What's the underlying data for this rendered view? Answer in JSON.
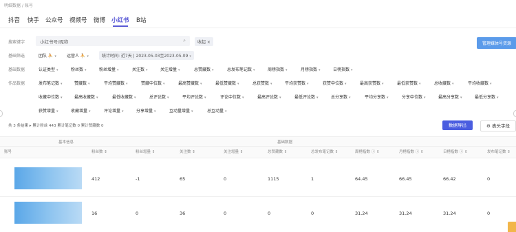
{
  "breadcrumb": "明细数据 / 账号",
  "tabs": [
    "抖音",
    "快手",
    "公众号",
    "视频号",
    "微博",
    "小红书",
    "B站"
  ],
  "search": {
    "label": "搜索键字",
    "placeholder": "小红书号/昵称",
    "tag": "收起 ×"
  },
  "manage_button": "管理媒体号资源",
  "basic_filter": {
    "label": "基础筛选",
    "team": "团队 ⛹",
    "operator": "运营人 ⛹",
    "period": "统计时间: 近7天 | 2023-05-03至2023-05-09"
  },
  "basic_data": {
    "label": "基础数据",
    "items": [
      "认证类型",
      "粉丝数",
      "粉丝增量",
      "关注数",
      "关注增量",
      "总赞藏数",
      "总发布笔记数",
      "周榜指数",
      "月榜指数",
      "日榜指数"
    ]
  },
  "works_data": {
    "label": "作品数据",
    "row1": [
      "发布笔记数",
      "赞藏数",
      "平均赞藏数",
      "赞藏中位数",
      "最高赞藏数",
      "最低赞藏数",
      "总获赞数",
      "平均获赞数",
      "获赞中位数",
      "最高获赞数",
      "最低获赞数",
      "总收藏数",
      "平均收藏数"
    ],
    "row2": [
      "收藏中位数",
      "最高收藏数",
      "最低收藏数",
      "总评论数",
      "平均评论数",
      "评论中位数",
      "最高评论数",
      "最低评论数",
      "总分享数",
      "平均分享数",
      "分享中位数",
      "最高分享数",
      "最低分享数"
    ],
    "row3": [
      "获赞增量",
      "收藏增量",
      "评论增量",
      "分享增量",
      "互动量增量",
      "总互动量"
    ]
  },
  "summary": "共 3 条结果  ▸  累计粉丝 443   累计笔记数 0   累计赞藏数 0",
  "export_button": "数据导出",
  "columns_button": "⚙ 表头字段",
  "table": {
    "group_basic": "基本信息",
    "group_data": "基础数据",
    "headers": [
      "账号",
      "粉丝数 ⇕",
      "粉丝增量 ⇕",
      "关注数 ⇕",
      "关注增量 ⇕",
      "总赞藏数 ⇕",
      "总发布笔记数 ⇕",
      "周榜指数 ⓘ ⇕",
      "月榜指数 ⓘ ⇕",
      "日榜指数 ⓘ ⇕",
      "发布笔记数 ⇕"
    ],
    "rows": [
      [
        "412",
        "-1",
        "65",
        "0",
        "1115",
        "1",
        "64.45",
        "66.45",
        "66.42",
        "0"
      ],
      [
        "16",
        "0",
        "36",
        "0",
        "0",
        "0",
        "31.24",
        "31.24",
        "31.24",
        "0"
      ]
    ]
  }
}
